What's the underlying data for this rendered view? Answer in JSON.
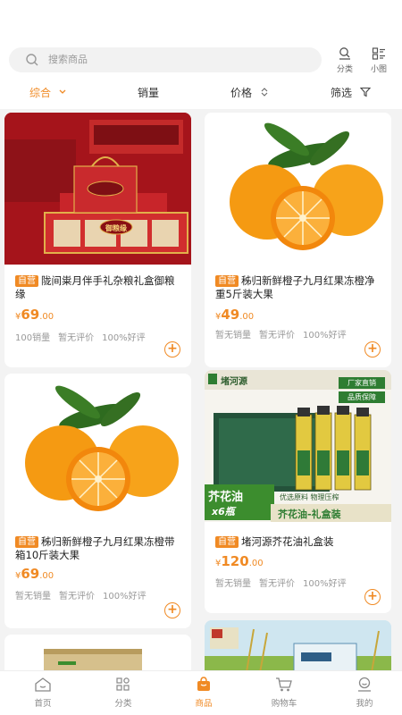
{
  "search": {
    "placeholder": "搜索商品"
  },
  "header_buttons": {
    "category": "分类",
    "small_grid": "小图"
  },
  "sort_tabs": [
    "综合",
    "销量",
    "价格",
    "筛选"
  ],
  "colors": {
    "accent": "#f08a24"
  },
  "products": [
    {
      "tag": "自营",
      "title": "陇间粜月伴手礼杂粮礼盒御粮缘",
      "price_symbol": "¥",
      "price_int": "69",
      "price_dec": ".00",
      "stats": [
        "100销量",
        "暂无评价",
        "100%好评"
      ],
      "image_text": "御粮缘"
    },
    {
      "tag": "自营",
      "title": "秭归新鲜橙子九月红果冻橙净重5斤装大果",
      "price_symbol": "¥",
      "price_int": "49",
      "price_dec": ".00",
      "stats": [
        "暂无销量",
        "暂无评价",
        "100%好评"
      ]
    },
    {
      "tag": "自营",
      "title": "秭归新鲜橙子九月红果冻橙带箱10斤装大果",
      "price_symbol": "¥",
      "price_int": "69",
      "price_dec": ".00",
      "stats": [
        "暂无销量",
        "暂无评价",
        "100%好评"
      ]
    },
    {
      "tag": "自营",
      "title": "堵河源芥花油礼盒装",
      "price_symbol": "¥",
      "price_int": "120",
      "price_dec": ".00",
      "stats": [
        "暂无销量",
        "暂无评价",
        "100%好评"
      ],
      "image_texts": {
        "brand": "堵河源",
        "badge1": "厂家直销",
        "badge2": "品质保障",
        "name": "芥花油",
        "qty": "x6瓶",
        "slogan": "优选原料 物理压榨",
        "banner": "芥花油-礼盒装"
      }
    }
  ],
  "tabbar": [
    {
      "label": "首页",
      "icon": "home-icon"
    },
    {
      "label": "分类",
      "icon": "category-icon"
    },
    {
      "label": "商品",
      "icon": "goods-icon"
    },
    {
      "label": "购物车",
      "icon": "cart-icon"
    },
    {
      "label": "我的",
      "icon": "profile-icon"
    }
  ]
}
